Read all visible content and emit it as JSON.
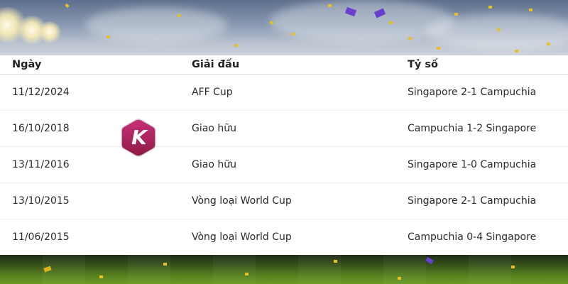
{
  "table": {
    "headers": [
      "Ngày",
      "Giải đấu",
      "Tỷ số"
    ],
    "rows": [
      [
        "11/12/2024",
        "AFF Cup",
        "Singapore 2-1 Campuchia"
      ],
      [
        "16/10/2018",
        "Giao hữu",
        "Campuchia 1-2 Singapore"
      ],
      [
        "13/11/2016",
        "Giao hữu",
        "Singapore 1-0 Campuchia"
      ],
      [
        "13/10/2015",
        "Vòng loại World Cup",
        "Singapore 2-1 Campuchia"
      ],
      [
        "11/06/2015",
        "Vòng loại World Cup",
        "Campuchia 0-4 Singapore"
      ]
    ]
  },
  "logo": {
    "icon": "k-logo-icon",
    "letter": "K",
    "color": "#b0245d"
  },
  "colors": {
    "sky": "#8a9ab2",
    "grass": "#55801e",
    "confetti": "#e6c02a",
    "confetti_purple": "#6a3fd0"
  }
}
